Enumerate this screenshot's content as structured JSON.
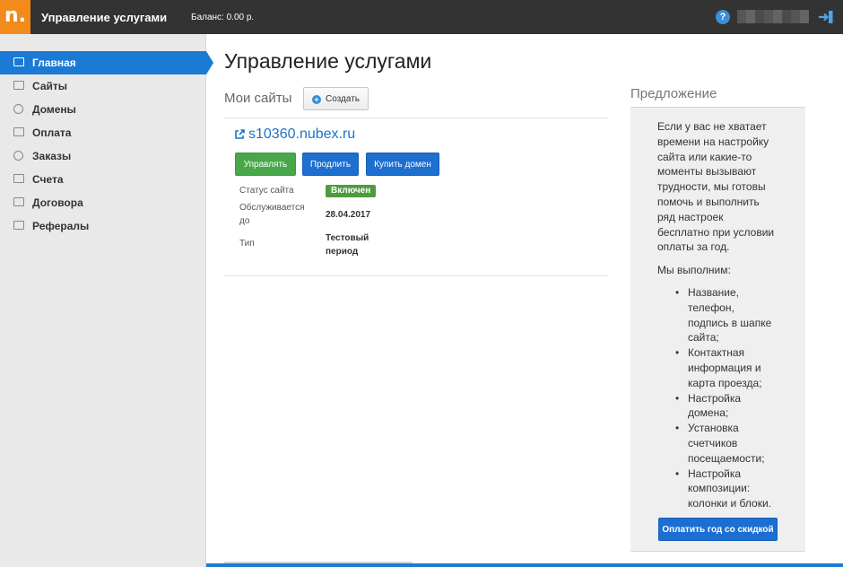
{
  "header": {
    "logo_letter": "n.",
    "title": "Управление услугами",
    "balance": "Баланс: 0.00 р.",
    "help_symbol": "?"
  },
  "sidebar": {
    "items": [
      {
        "label": "Главная",
        "icon": "home-icon",
        "active": true
      },
      {
        "label": "Сайты",
        "icon": "sites-icon"
      },
      {
        "label": "Домены",
        "icon": "globe-icon"
      },
      {
        "label": "Оплата",
        "icon": "payment-icon"
      },
      {
        "label": "Заказы",
        "icon": "orders-icon"
      },
      {
        "label": "Счета",
        "icon": "invoices-icon"
      },
      {
        "label": "Договора",
        "icon": "contracts-icon"
      },
      {
        "label": "Рефералы",
        "icon": "referrals-icon"
      }
    ]
  },
  "main": {
    "title": "Управление услугами",
    "my_sites_label": "Мои сайты",
    "create_label": "Создать",
    "site": {
      "domain": "s10360.nubex.ru",
      "buttons": {
        "manage": "Управлять",
        "extend": "Продлить",
        "buy_domain": "Купить домен"
      },
      "status_label": "Статус сайта",
      "status_value": "Включен",
      "served_until_label_1": "Обслуживается",
      "served_until_label_2": "до",
      "served_until_value": "28.04.2017",
      "type_label": "Тип",
      "type_value_1": "Тестовый",
      "type_value_2": "период"
    }
  },
  "offer": {
    "title": "Предложение",
    "text_lines": [
      "Если у вас не хватает",
      "времени на настройку",
      "сайта или какие-то",
      "моменты вызывают",
      "трудности, мы готовы",
      "помочь и выполнить",
      "ряд настроек",
      "бесплатно при условии",
      "оплаты за год."
    ],
    "sub": "Мы выполним:",
    "items": [
      [
        "Название,",
        "телефон,",
        "подпись в шапке",
        "сайта;"
      ],
      [
        "Контактная",
        "информация и",
        "карта проезда;"
      ],
      [
        "Настройка",
        "домена;"
      ],
      [
        "Установка",
        "счетчиков",
        "посещаемости;"
      ],
      [
        "Настройка",
        "композиции:",
        "колонки и блоки."
      ]
    ],
    "button": "Оплатить год со скидкой"
  },
  "colors": {
    "topbar": "#333333",
    "logo": "#f28a1c",
    "accent": "#1b7ad4",
    "green": "#48a849",
    "link": "#1b73c9"
  }
}
